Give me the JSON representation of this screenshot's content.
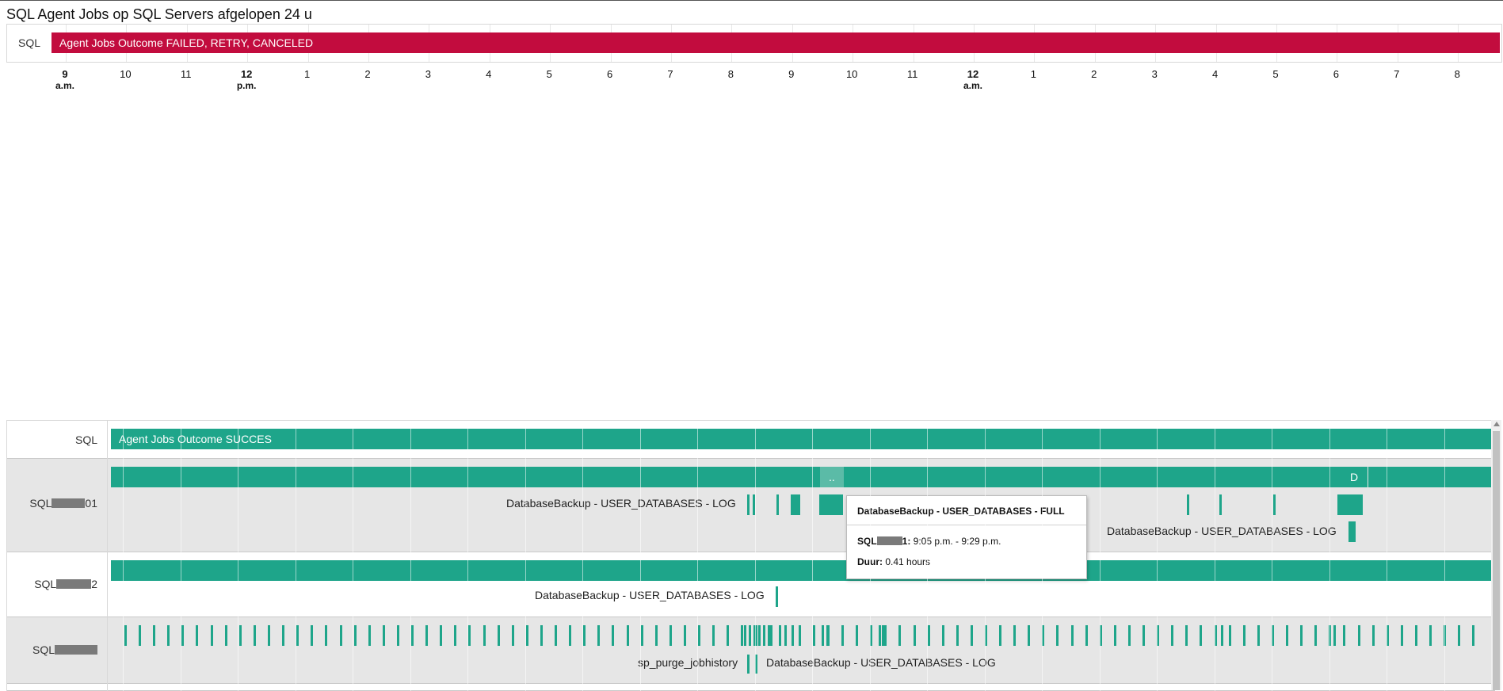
{
  "title": "SQL Agent Jobs op SQL Servers afgelopen 24 u",
  "colors": {
    "failed": "#c20c3e",
    "success": "#1ea58a",
    "band": "#e6e6e6"
  },
  "failed_timeline": {
    "row_label": "SQL",
    "bar_label": "Agent Jobs Outcome FAILED, RETRY, CANCELED"
  },
  "axis_ticks": [
    {
      "label": "9",
      "sub": "a.m."
    },
    {
      "label": "10",
      "sub": ""
    },
    {
      "label": "11",
      "sub": ""
    },
    {
      "label": "12",
      "sub": "p.m."
    },
    {
      "label": "1",
      "sub": ""
    },
    {
      "label": "2",
      "sub": ""
    },
    {
      "label": "3",
      "sub": ""
    },
    {
      "label": "4",
      "sub": ""
    },
    {
      "label": "5",
      "sub": ""
    },
    {
      "label": "6",
      "sub": ""
    },
    {
      "label": "7",
      "sub": ""
    },
    {
      "label": "8",
      "sub": ""
    },
    {
      "label": "9",
      "sub": ""
    },
    {
      "label": "10",
      "sub": ""
    },
    {
      "label": "11",
      "sub": ""
    },
    {
      "label": "12",
      "sub": "a.m."
    },
    {
      "label": "1",
      "sub": ""
    },
    {
      "label": "2",
      "sub": ""
    },
    {
      "label": "3",
      "sub": ""
    },
    {
      "label": "4",
      "sub": ""
    },
    {
      "label": "5",
      "sub": ""
    },
    {
      "label": "6",
      "sub": ""
    },
    {
      "label": "7",
      "sub": ""
    },
    {
      "label": "8",
      "sub": ""
    }
  ],
  "success_timeline": {
    "row_label": "SQL",
    "bar_label": "Agent Jobs Outcome SUCCES",
    "servers": [
      {
        "name_prefix": "SQL",
        "name_suffix": "01",
        "bar_markers": [
          "..",
          "D"
        ],
        "job_labels": [
          "DatabaseBackup - USER_DATABASES - LOG",
          "DatabaseBackup - USER_DATABASES - LOG"
        ]
      },
      {
        "name_prefix": "SQL",
        "name_suffix": "2",
        "job_labels": [
          "DatabaseBackup - USER_DATABASES - LOG"
        ]
      },
      {
        "name_prefix": "SQL",
        "name_suffix": "",
        "job_labels": [
          "sp_purge_jobhistory",
          "DatabaseBackup - USER_DATABASES - LOG"
        ]
      }
    ]
  },
  "tooltip": {
    "title": "DatabaseBackup - USER_DATABASES - FULL",
    "server_prefix": "SQL",
    "server_suffix": "1:",
    "time_range": " 9:05 p.m. - 9:29 p.m.",
    "duration_label": "Duur:",
    "duration_value": " 0.41 hours"
  }
}
